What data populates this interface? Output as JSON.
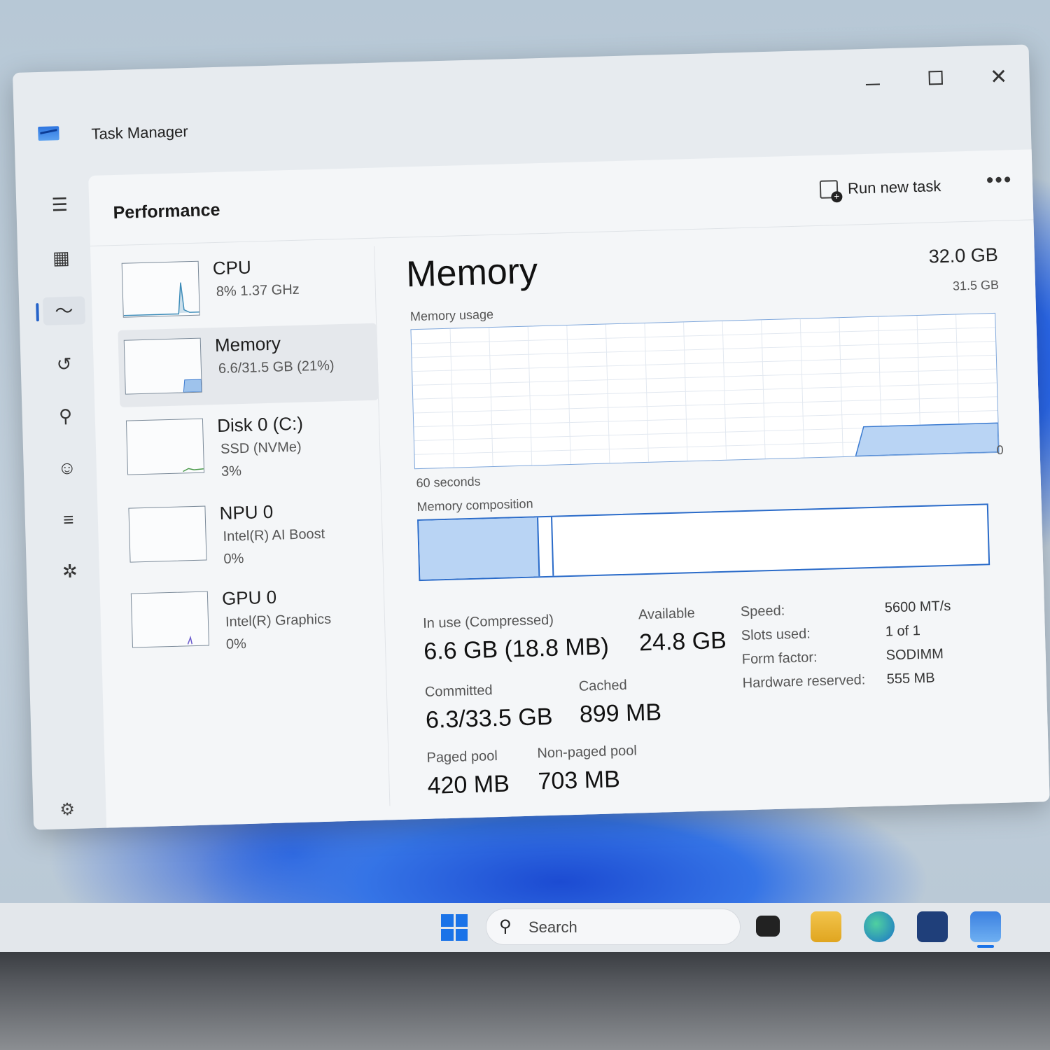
{
  "window": {
    "title": "Task Manager",
    "minimize_glyph": "",
    "close_glyph": "✕"
  },
  "nav": {
    "menu_icon": "hamburger-icon",
    "items": [
      "processes-icon",
      "performance-icon",
      "app-history-icon",
      "startup-apps-icon",
      "users-icon",
      "details-icon",
      "services-icon"
    ],
    "settings_icon": "gear-icon"
  },
  "header": {
    "title": "Performance",
    "run_new_task": "Run new task",
    "more": "•••"
  },
  "devices": [
    {
      "name": "CPU",
      "sub1": "8%  1.37 GHz",
      "sub2": ""
    },
    {
      "name": "Memory",
      "sub1": "6.6/31.5 GB (21%)",
      "sub2": ""
    },
    {
      "name": "Disk 0 (C:)",
      "sub1": "SSD (NVMe)",
      "sub2": "3%"
    },
    {
      "name": "NPU 0",
      "sub1": "Intel(R) AI Boost",
      "sub2": "0%"
    },
    {
      "name": "GPU 0",
      "sub1": "Intel(R) Graphics",
      "sub2": "0%"
    }
  ],
  "memory": {
    "title": "Memory",
    "total": "32.0 GB",
    "usage_label": "Memory usage",
    "usage_max": "31.5 GB",
    "axis_left": "60 seconds",
    "axis_right": "0",
    "composition_label": "Memory composition",
    "in_use_fraction": 0.21,
    "stats": {
      "in_use_label": "In use (Compressed)",
      "in_use_value": "6.6 GB (18.8 MB)",
      "available_label": "Available",
      "available_value": "24.8 GB",
      "committed_label": "Committed",
      "committed_value": "6.3/33.5 GB",
      "cached_label": "Cached",
      "cached_value": "899 MB",
      "paged_label": "Paged pool",
      "paged_value": "420 MB",
      "nonpaged_label": "Non-paged pool",
      "nonpaged_value": "703 MB"
    },
    "specs": [
      {
        "key": "Speed:",
        "value": "5600 MT/s"
      },
      {
        "key": "Slots used:",
        "value": "1 of 1"
      },
      {
        "key": "Form factor:",
        "value": "SODIMM"
      },
      {
        "key": "Hardware reserved:",
        "value": "555 MB"
      }
    ]
  },
  "taskbar": {
    "search_placeholder": "Search"
  }
}
